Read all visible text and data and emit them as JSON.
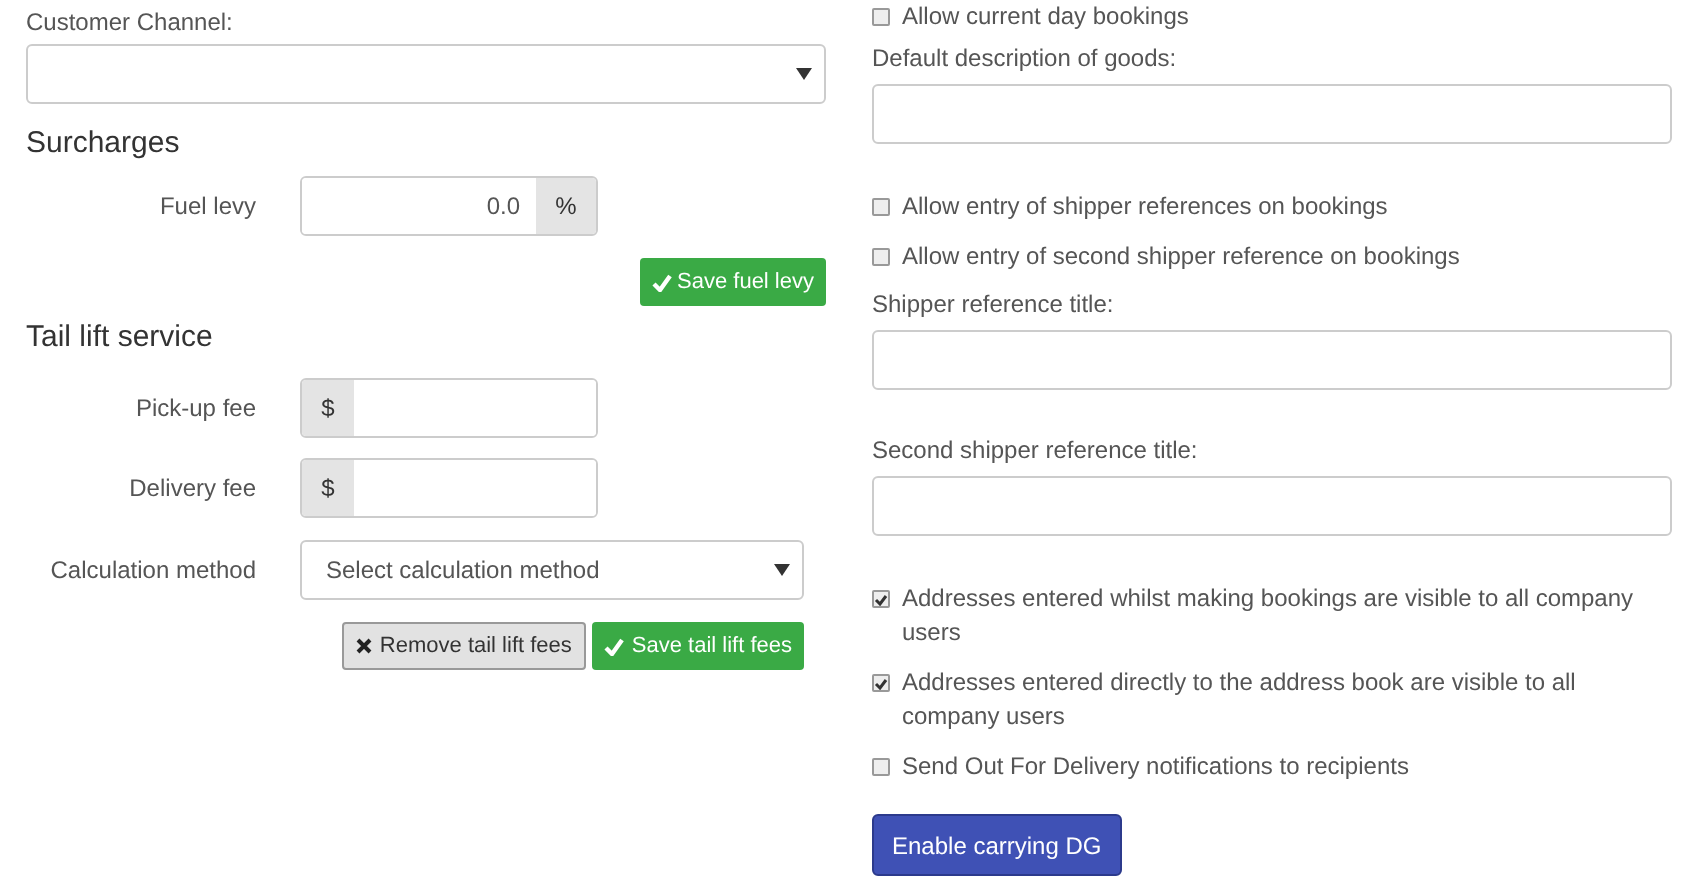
{
  "customer_channel": {
    "label": "Customer Channel:"
  },
  "surcharges": {
    "heading": "Surcharges",
    "fuel_levy": {
      "label": "Fuel levy",
      "value": "0.0",
      "suffix": "%"
    },
    "save_button": "Save fuel levy"
  },
  "tail_lift": {
    "heading": "Tail lift service",
    "fees": [
      {
        "label": "Pick-up fee",
        "prefix": "$"
      },
      {
        "label": "Delivery fee",
        "prefix": "$"
      }
    ],
    "calculation": {
      "label": "Calculation method",
      "placeholder": "Select calculation method"
    },
    "buttons": [
      {
        "kind": "remove",
        "label": "Remove tail lift fees"
      },
      {
        "kind": "save",
        "label": "Save tail lift fees"
      }
    ]
  },
  "settings": [
    {
      "kind": "checkbox",
      "label": "Allow current day bookings",
      "checked": false
    },
    {
      "kind": "field",
      "label": "Default description of goods:"
    },
    {
      "kind": "checkbox",
      "label": "Allow entry of shipper references on bookings",
      "checked": false
    },
    {
      "kind": "checkbox",
      "label": "Allow entry of second shipper reference on bookings",
      "checked": false
    },
    {
      "kind": "field",
      "label": "Shipper reference title:"
    },
    {
      "kind": "field",
      "label": "Second shipper reference title:"
    },
    {
      "kind": "checkbox",
      "label": "Addresses entered whilst making bookings are visible to all company users",
      "checked": true
    },
    {
      "kind": "checkbox",
      "label": "Addresses entered directly to the address book are visible to all company users",
      "checked": true
    },
    {
      "kind": "checkbox",
      "label": "Send Out For Delivery notifications to recipients",
      "checked": false
    },
    {
      "kind": "button",
      "label": "Enable carrying DG"
    }
  ]
}
